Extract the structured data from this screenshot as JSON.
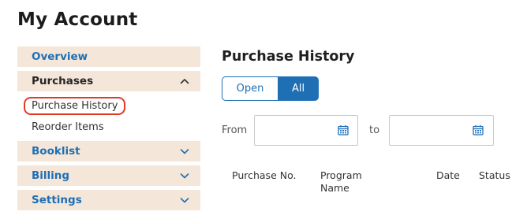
{
  "header": {
    "title": "My Account"
  },
  "sidebar": {
    "overview": "Overview",
    "purchases": {
      "label": "Purchases",
      "items": [
        "Purchase History",
        "Reorder Items"
      ]
    },
    "booklist": "Booklist",
    "billing": "Billing",
    "settings": "Settings"
  },
  "main": {
    "title": "Purchase History",
    "toggle": {
      "open": "Open",
      "all": "All",
      "selected": "All"
    },
    "filter": {
      "from_label": "From",
      "to_label": "to",
      "from_value": "",
      "to_value": ""
    },
    "table": {
      "headers": [
        "Purchase No.",
        "Program Name",
        "Date",
        "Status"
      ]
    }
  },
  "colors": {
    "accent": "#1f6fb5",
    "sidebar_bg": "#f4e6d8",
    "highlight_ring": "#e03a24"
  },
  "icons": {
    "expand": "chevron-down-icon",
    "collapse": "chevron-up-icon",
    "calendar": "calendar-icon"
  }
}
